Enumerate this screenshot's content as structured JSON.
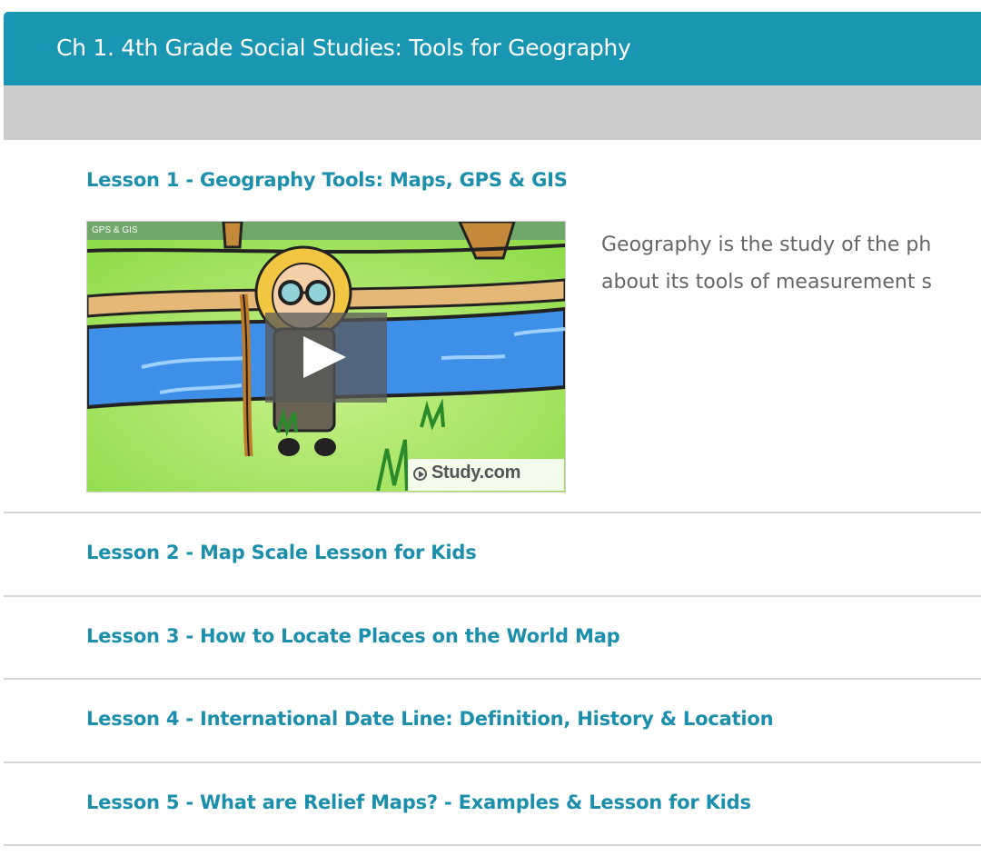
{
  "chapter": {
    "title": "Ch 1. 4th Grade Social Studies: Tools for Geography"
  },
  "lessons": [
    {
      "title": "Lesson 1 - Geography Tools: Maps, GPS & GIS",
      "video": {
        "label": "GPS & GIS",
        "watermark": "Study.com",
        "play_icon": "play-icon"
      },
      "description_lines": [
        "Geography is the study of the ph",
        "about its tools of measurement s"
      ]
    },
    {
      "title": "Lesson 2 - Map Scale Lesson for Kids"
    },
    {
      "title": "Lesson 3 - How to Locate Places on the World Map"
    },
    {
      "title": "Lesson 4 - International Date Line: Definition, History & Location"
    },
    {
      "title": "Lesson 5 - What are Relief Maps? - Examples & Lesson for Kids"
    }
  ],
  "colors": {
    "header_bg": "#1896b2",
    "subbar_bg": "#cccccc",
    "link": "#1b8fac",
    "body_text": "#666666"
  }
}
